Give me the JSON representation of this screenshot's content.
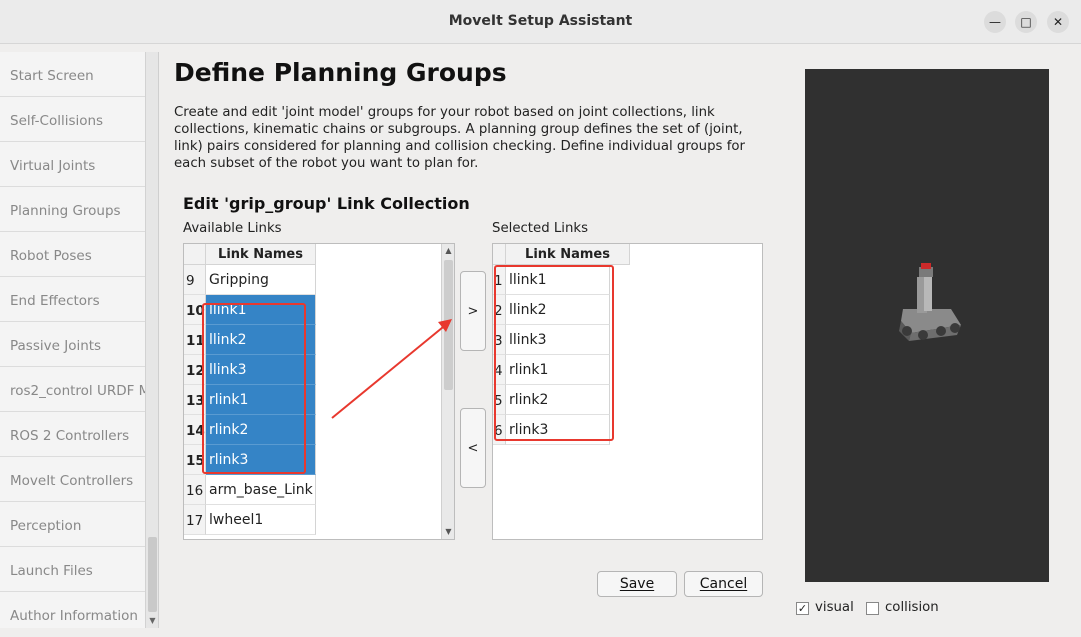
{
  "window": {
    "title": "MoveIt Setup Assistant"
  },
  "sidebar": {
    "items": [
      {
        "label": "Start Screen"
      },
      {
        "label": "Self-Collisions"
      },
      {
        "label": "Virtual Joints"
      },
      {
        "label": "Planning Groups"
      },
      {
        "label": "Robot Poses"
      },
      {
        "label": "End Effectors"
      },
      {
        "label": "Passive Joints"
      },
      {
        "label": "ros2_control URDF M"
      },
      {
        "label": "ROS 2 Controllers"
      },
      {
        "label": "MoveIt Controllers"
      },
      {
        "label": "Perception"
      },
      {
        "label": "Launch Files"
      },
      {
        "label": "Author Information"
      }
    ]
  },
  "main": {
    "title": "Define Planning Groups",
    "description": "Create and edit 'joint model' groups for your robot based on joint collections, link collections, kinematic chains or subgroups. A planning group defines the set of (joint, link) pairs considered for planning and collision checking. Define individual groups for each subset of the robot you want to plan for.",
    "subtitle": "Edit 'grip_group' Link Collection",
    "available": {
      "label": "Available Links",
      "header": "Link Names",
      "rows": [
        {
          "num": "9",
          "name": "Gripping"
        },
        {
          "num": "10",
          "name": "llink1"
        },
        {
          "num": "11",
          "name": "llink2"
        },
        {
          "num": "12",
          "name": "llink3"
        },
        {
          "num": "13",
          "name": "rlink1"
        },
        {
          "num": "14",
          "name": "rlink2"
        },
        {
          "num": "15",
          "name": "rlink3"
        },
        {
          "num": "16",
          "name": "arm_base_Link"
        },
        {
          "num": "17",
          "name": "lwheel1"
        }
      ]
    },
    "selected": {
      "label": "Selected Links",
      "header": "Link Names",
      "rows": [
        {
          "num": "1",
          "name": "llink1"
        },
        {
          "num": "2",
          "name": "llink2"
        },
        {
          "num": "3",
          "name": "llink3"
        },
        {
          "num": "4",
          "name": "rlink1"
        },
        {
          "num": "5",
          "name": "rlink2"
        },
        {
          "num": "6",
          "name": "rlink3"
        }
      ]
    },
    "add_label": ">",
    "remove_label": "<",
    "save_label": "Save",
    "cancel_label": "Cancel"
  },
  "viewer": {
    "visual_label": "visual",
    "visual_checked": true,
    "collision_label": "collision",
    "collision_checked": false
  },
  "colors": {
    "selection": "#3584c6",
    "annotation": "#e8382e",
    "viewer_bg": "#303030"
  }
}
